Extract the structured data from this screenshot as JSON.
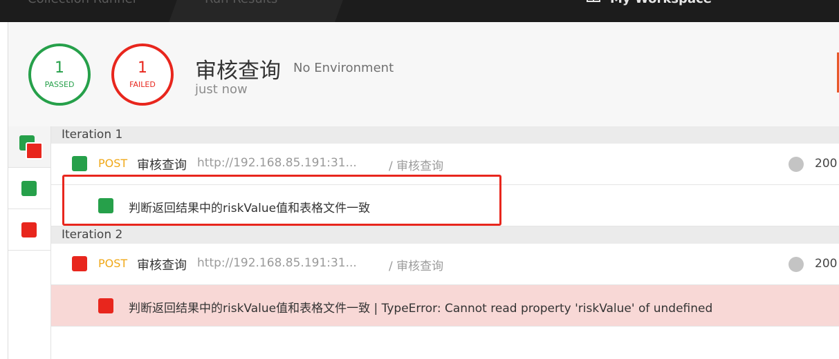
{
  "topbar": {
    "tabs": [
      "Collection Runner",
      "Run Results"
    ],
    "workspace": "My Workspace",
    "workspace_icon": "workspace-icon"
  },
  "summary": {
    "passed_count": "1",
    "passed_label": "PASSED",
    "failed_count": "1",
    "failed_label": "FAILED",
    "title": "审核查询",
    "environment": "No Environment",
    "time": "just now"
  },
  "iterations": [
    {
      "header": "Iteration 1",
      "request": {
        "status": "passed",
        "method": "POST",
        "name": "审核查询",
        "url": "http://192.168.85.191:31...",
        "path": "/ 审核查询",
        "code": "200"
      },
      "test": {
        "status": "passed",
        "text": "判断返回结果中的riskValue值和表格文件一致"
      }
    },
    {
      "header": "Iteration 2",
      "request": {
        "status": "failed",
        "method": "POST",
        "name": "审核查询",
        "url": "http://192.168.85.191:31...",
        "path": "/ 审核查询",
        "code": "200"
      },
      "test": {
        "status": "failed",
        "text": "判断返回结果中的riskValue值和表格文件一致 | TypeError: Cannot read property 'riskValue' of undefined"
      }
    }
  ],
  "colors": {
    "passed": "#26a04a",
    "failed": "#e8261d",
    "method_post": "#f0a818",
    "failed_row_bg": "#f8d8d6"
  }
}
